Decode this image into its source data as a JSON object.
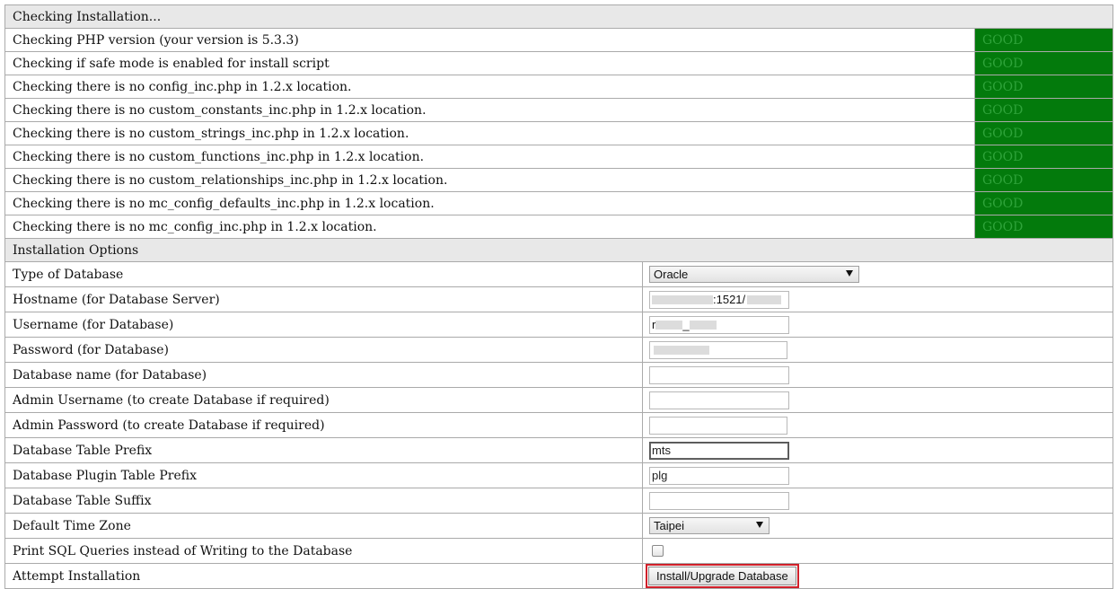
{
  "checks": {
    "header": "Checking Installation...",
    "rows": [
      {
        "label": "Checking PHP version (your version is 5.3.3)",
        "status": "GOOD"
      },
      {
        "label": "Checking if safe mode is enabled for install script",
        "status": "GOOD"
      },
      {
        "label": "Checking there is no config_inc.php in 1.2.x location.",
        "status": "GOOD"
      },
      {
        "label": "Checking there is no custom_constants_inc.php in 1.2.x location.",
        "status": "GOOD"
      },
      {
        "label": "Checking there is no custom_strings_inc.php in 1.2.x location.",
        "status": "GOOD"
      },
      {
        "label": "Checking there is no custom_functions_inc.php in 1.2.x location.",
        "status": "GOOD"
      },
      {
        "label": "Checking there is no custom_relationships_inc.php in 1.2.x location.",
        "status": "GOOD"
      },
      {
        "label": "Checking there is no mc_config_defaults_inc.php in 1.2.x location.",
        "status": "GOOD"
      },
      {
        "label": "Checking there is no mc_config_inc.php in 1.2.x location.",
        "status": "GOOD"
      }
    ],
    "status_color": "#037a0c"
  },
  "options": {
    "header": "Installation Options",
    "db_type_label": "Type of Database",
    "db_type_value": "Oracle",
    "hostname_label": "Hostname (for Database Server)",
    "hostname_visible": ":1521/",
    "username_label": "Username (for Database)",
    "username_visible_a": "r",
    "username_visible_b": "_",
    "password_label": "Password (for Database)",
    "dbname_label": "Database name (for Database)",
    "dbname_value": "",
    "admin_user_label": "Admin Username (to create Database if required)",
    "admin_user_value": "",
    "admin_pass_label": "Admin Password (to create Database if required)",
    "admin_pass_value": "",
    "prefix_label": "Database Table Prefix",
    "prefix_value": "mts",
    "plugin_prefix_label": "Database Plugin Table Prefix",
    "plugin_prefix_value": "plg",
    "suffix_label": "Database Table Suffix",
    "suffix_value": "",
    "timezone_label": "Default Time Zone",
    "timezone_value": "Taipei",
    "print_sql_label": "Print SQL Queries instead of Writing to the Database",
    "print_sql_checked": false,
    "attempt_label": "Attempt Installation",
    "install_button": "Install/Upgrade Database",
    "highlight_color": "#d0202a"
  }
}
